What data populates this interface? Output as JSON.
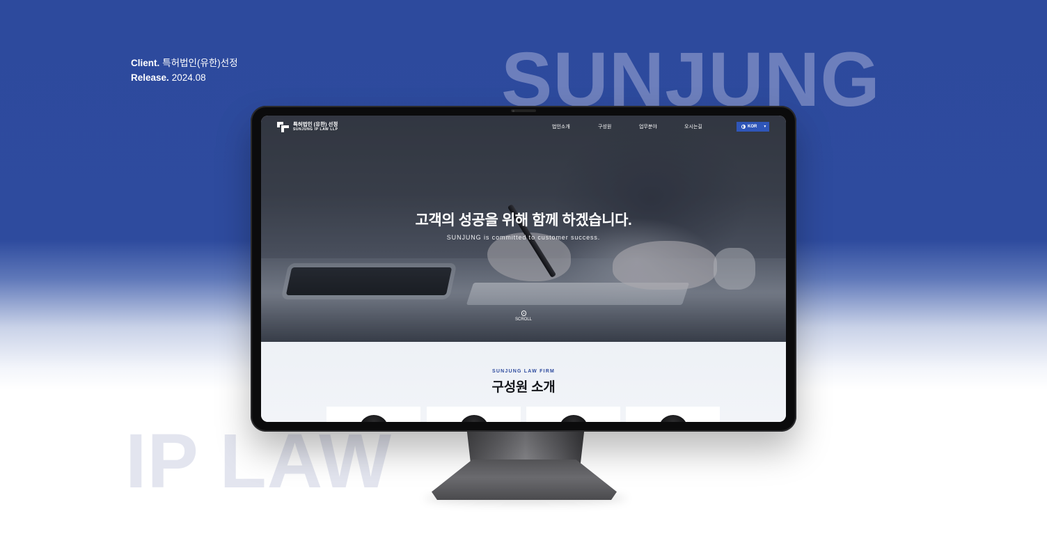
{
  "meta": {
    "client_label": "Client.",
    "client_value": "특허법인(유한)선정",
    "release_label": "Release.",
    "release_value": "2024.08"
  },
  "backdrop": {
    "top_word": "SUNJUNG",
    "bottom_word": "IP LAW"
  },
  "site": {
    "logo_ko": "특허법인 (유한) 선정",
    "logo_en": "SUNJUNG IP LAW LLP",
    "nav": [
      "법인소개",
      "구성원",
      "업무분야",
      "오시는길"
    ],
    "lang_button": "KOR",
    "hero_title": "고객의 성공을 위해 함께 하겠습니다.",
    "hero_subtitle": "SUNJUNG is committed to customer success.",
    "scroll_label": "SCROLL",
    "section_eyebrow": "SUNJUNG LAW FIRM",
    "section_title": "구성원 소개"
  },
  "colors": {
    "brand_blue": "#2e4b9e",
    "lang_button_bg": "#2f56b8"
  }
}
